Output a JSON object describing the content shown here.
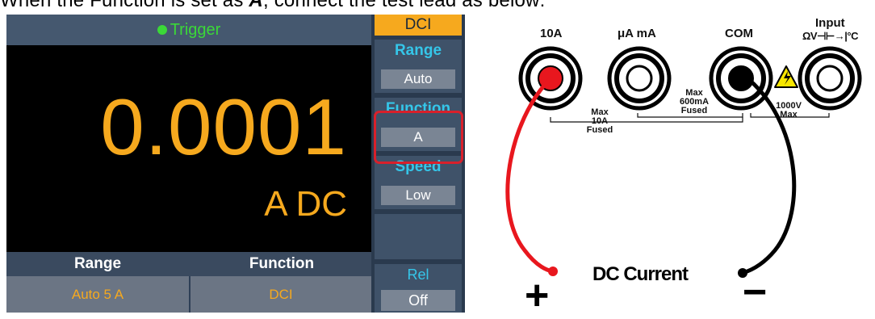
{
  "caption": {
    "before": "When the Function is set as ",
    "highlight": "A",
    "after": ", connect the test lead as below:"
  },
  "meter": {
    "trigger_label": "Trigger",
    "reading": "0.0001",
    "unit": "A DC",
    "bottom_headers": [
      "Range",
      "Function"
    ],
    "bottom_values": [
      "Auto 5 A",
      "DCI"
    ],
    "mode_tab": "DCI",
    "menu": [
      {
        "label": "Range",
        "value": "Auto"
      },
      {
        "label": "Function",
        "value": "A"
      },
      {
        "label": "Speed",
        "value": "Low"
      }
    ],
    "rel": {
      "label": "Rel",
      "value": "Off"
    },
    "colors": {
      "reading": "#f6a91e",
      "trigger": "#3bd838",
      "menu_label": "#35c6e9",
      "highlight": "#d8202b"
    }
  },
  "diagram": {
    "jacks": [
      {
        "label": "10A"
      },
      {
        "label": "μA mA"
      },
      {
        "label": "COM"
      },
      {
        "label": "Input",
        "symbols": "ΩV⊣⊢→|°C"
      }
    ],
    "ratings": {
      "r10a": [
        "Max",
        "10A",
        "Fused"
      ],
      "r600": [
        "Max",
        "600mA",
        "Fused"
      ],
      "r1000": [
        "1000V",
        "Max"
      ]
    },
    "current_label": "DC Current",
    "plus": "+",
    "minus": "−",
    "lead_colors": {
      "positive": "#e8171e",
      "negative": "#000000"
    }
  }
}
